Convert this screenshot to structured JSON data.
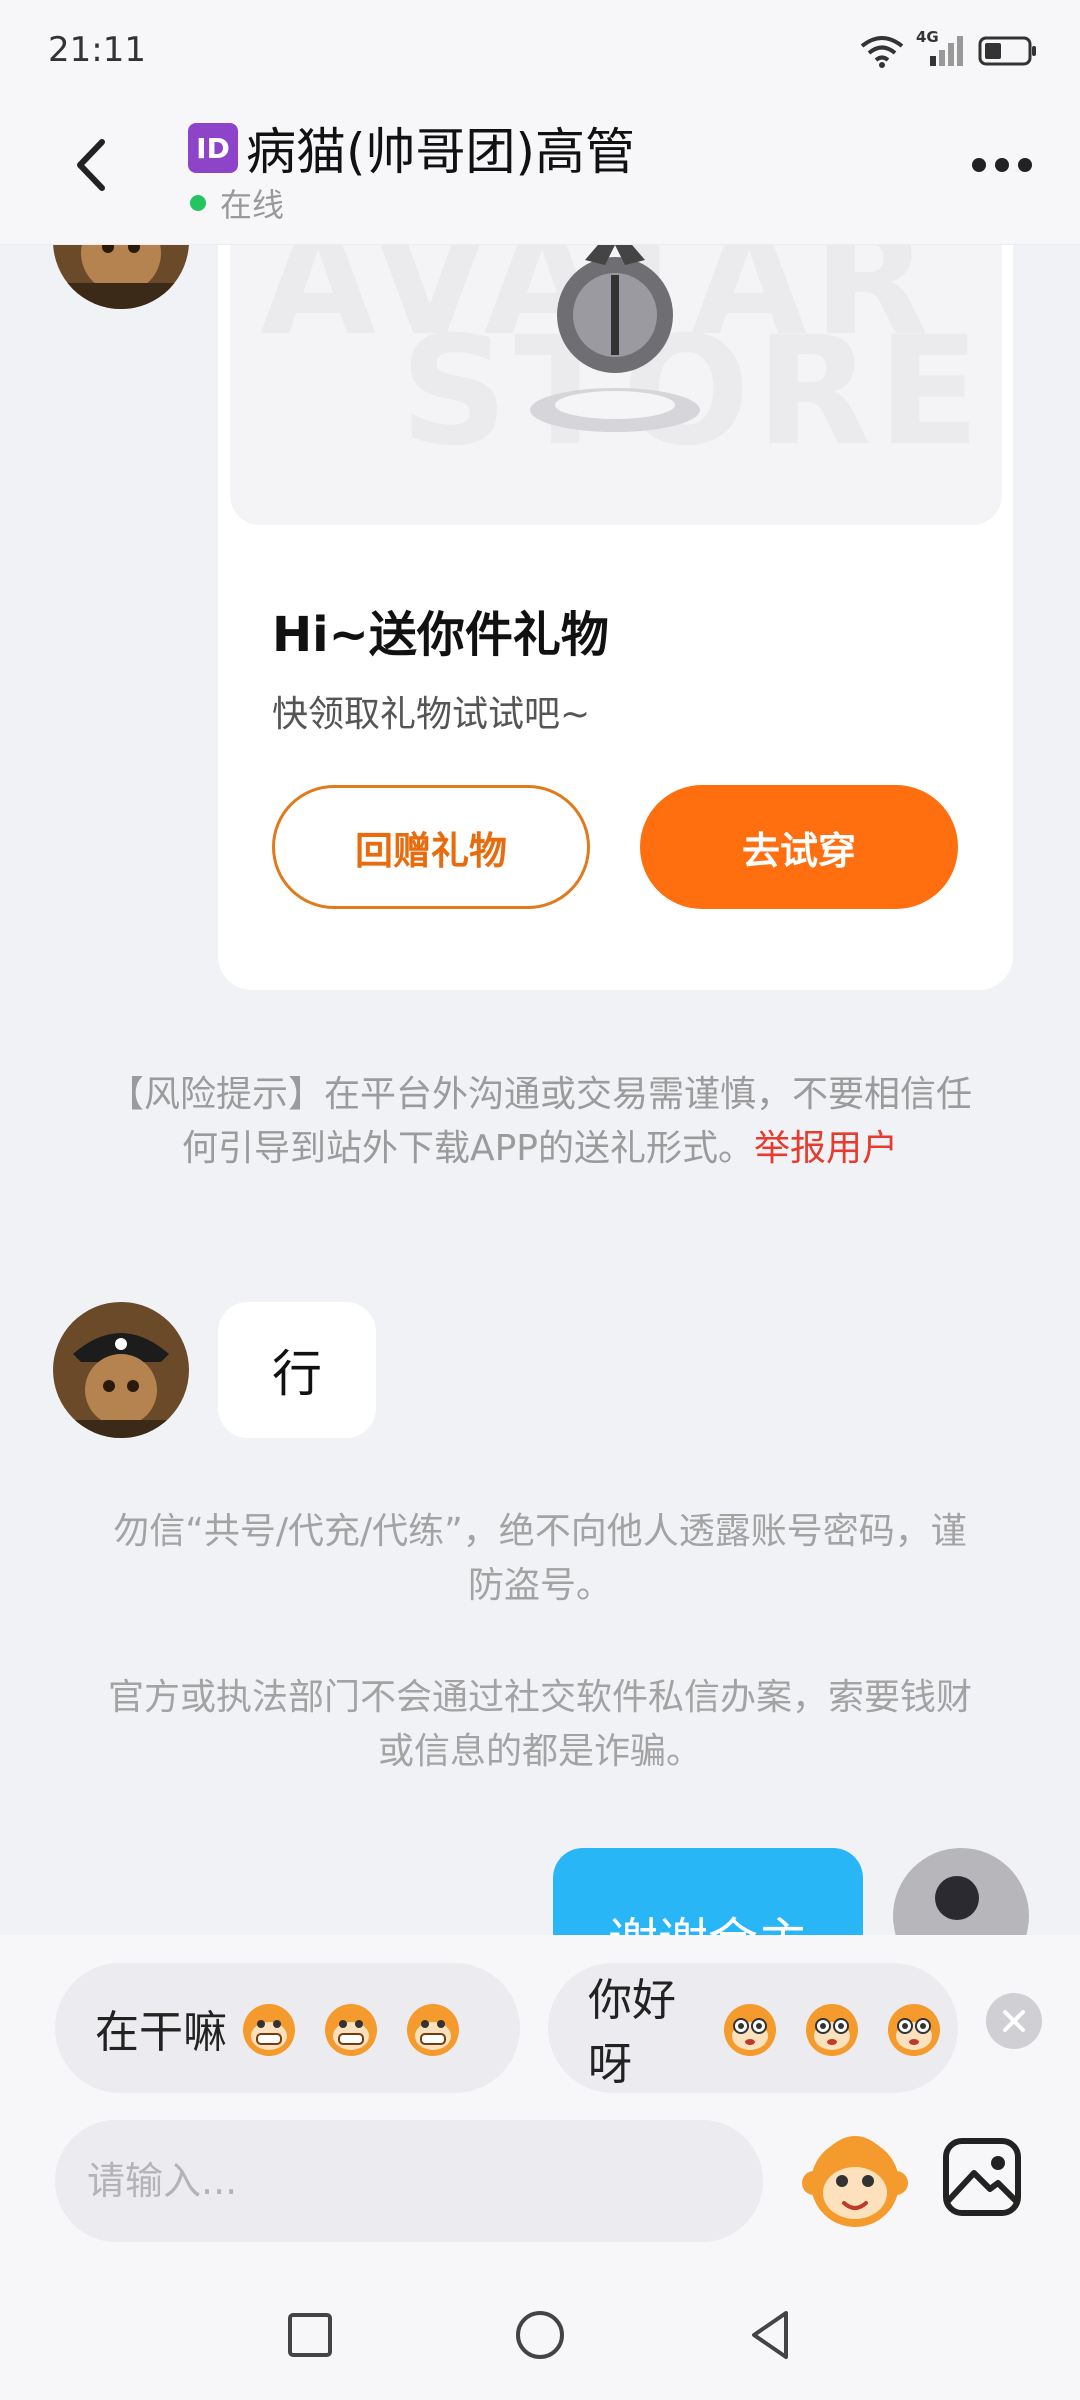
{
  "status_bar": {
    "time": "21:11",
    "network": "4G"
  },
  "header": {
    "id_badge": "ID",
    "title": "病猫(帅哥团)高管",
    "status": "在线"
  },
  "gift_card": {
    "image_text_1": "AVATAR",
    "image_text_2": "STORE",
    "title": "Hi~送你件礼物",
    "subtitle": "快领取礼物试试吧~",
    "return_gift_label": "回赠礼物",
    "try_on_label": "去试穿"
  },
  "risk_notice": {
    "text": "【风险提示】在平台外沟通或交易需谨慎，不要相信任何引导到站外下载APP的送礼形式。",
    "report_link": "举报用户"
  },
  "messages": [
    {
      "side": "left",
      "text": "行"
    },
    {
      "side": "right",
      "text": "谢谢金主"
    }
  ],
  "system_notices": {
    "line1": "勿信“共号/代充/代练”，绝不向他人透露账号密码，谨防盗号。",
    "line2": "官方或执法部门不会通过社交软件私信办案，索要钱财或信息的都是诈骗。"
  },
  "quick_replies": [
    {
      "text": "在干嘛"
    },
    {
      "text": "你好呀"
    }
  ],
  "composer": {
    "placeholder": "请输入..."
  },
  "colors": {
    "accent_orange": "#ff6f0f",
    "bubble_blue": "#29b6f6",
    "report_red": "#e63b2e",
    "online_green": "#22c55e"
  }
}
